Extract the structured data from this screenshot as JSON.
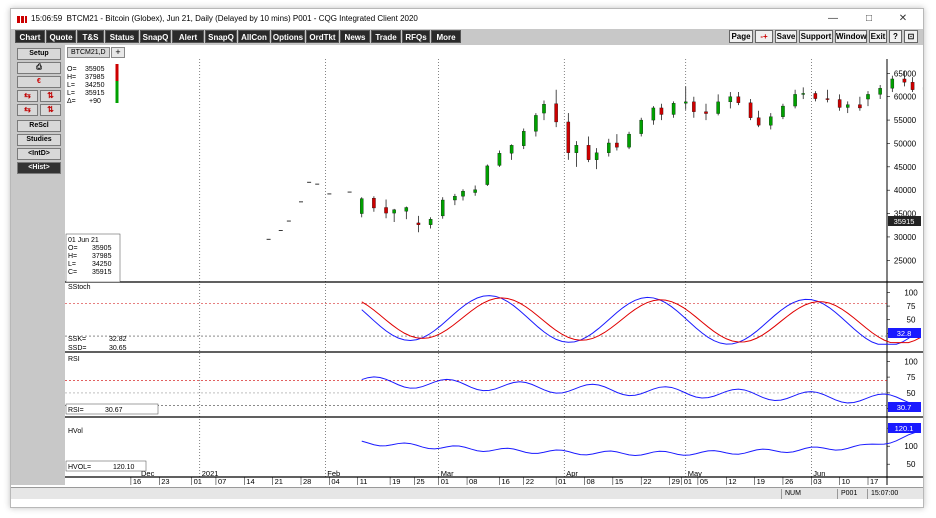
{
  "window": {
    "time": "15:06:59",
    "title": "BTCM21 - Bitcoin (Globex), Jun 21, Daily (Delayed by 10 mins)   P001 - CQG Integrated Client 2020",
    "minimize": "—",
    "maximize": "□",
    "close": "✕"
  },
  "toolbar": {
    "left_buttons": [
      "Chart",
      "Quote",
      "T&S",
      "Status",
      "SnapQ",
      "Alert",
      "SnapQ",
      "AllCon",
      "Options",
      "OrdTkt",
      "News",
      "Trade",
      "RFQs",
      "More"
    ],
    "right_buttons": [
      "Page",
      "-+",
      "Save",
      "Support",
      "Window",
      "Exit",
      "?"
    ]
  },
  "sidebar": {
    "setup": "Setup",
    "print_icon": "printer-icon",
    "rescl": "ReScl",
    "studies": "Studies",
    "intd": "<IntD>",
    "hist": "<Hist>"
  },
  "tab": {
    "label": "BTCM21,D",
    "add": "+"
  },
  "ohlc_box": {
    "open_label": "O=",
    "open": "35905",
    "high_label": "H=",
    "high": "37985",
    "low_label": "L=",
    "low": "34250",
    "last_label": "L=",
    "last": "35915",
    "change_label": "Δ=",
    "change": "+90"
  },
  "cursor_box": {
    "date": "01  Jun 21",
    "o_label": "O=",
    "o": "35905",
    "h_label": "H=",
    "h": "37985",
    "l_label": "L=",
    "l": "34250",
    "c_label": "C=",
    "c": "35915"
  },
  "panels": {
    "sstoch": {
      "title": "SStoch",
      "ssk_label": "SSK=",
      "ssk": "32.82",
      "ssd_label": "SSD=",
      "ssd": "30.65",
      "badge": "32.8"
    },
    "rsi": {
      "title": "RSI",
      "value_label": "RSI=",
      "value": "30.67",
      "badge": "30.7"
    },
    "hvol": {
      "title": "HVol",
      "value_label": "HVOL=",
      "value": "120.10",
      "badge": "120.1"
    }
  },
  "price_badge": "35915",
  "statusbar": {
    "num": "NUM",
    "page": "P001",
    "time": "15:07:00"
  },
  "colors": {
    "up": "#00a000",
    "down": "#cc0000",
    "fast": "#1a1aff",
    "slow": "#e00000",
    "badge": "#1a1aff"
  },
  "chart_data": {
    "type": "candlestick",
    "price_axis": {
      "ticks": [
        25000,
        30000,
        35000,
        40000,
        45000,
        50000,
        55000,
        60000,
        65000
      ],
      "range": [
        21000,
        67000
      ]
    },
    "sstoch_axis": {
      "ticks": [
        100,
        75,
        50,
        25
      ]
    },
    "rsi_axis": {
      "ticks": [
        100,
        75,
        50,
        25
      ]
    },
    "hvol_axis": {
      "ticks": [
        150,
        100,
        50
      ]
    },
    "month_labels": [
      {
        "label": "Dec",
        "day": 0
      },
      {
        "label": "2021",
        "day": 15
      },
      {
        "label": "Feb",
        "day": 46
      },
      {
        "label": "Mar",
        "day": 74
      },
      {
        "label": "Apr",
        "day": 105
      },
      {
        "label": "May",
        "day": 135
      },
      {
        "label": "Jun",
        "day": 166
      }
    ],
    "day_labels": [
      {
        "label": "16",
        "day": -2
      },
      {
        "label": "23",
        "day": 5
      },
      {
        "label": "01",
        "day": 13
      },
      {
        "label": "07",
        "day": 19
      },
      {
        "label": "14",
        "day": 26
      },
      {
        "label": "21",
        "day": 33
      },
      {
        "label": "28",
        "day": 40
      },
      {
        "label": "04",
        "day": 47
      },
      {
        "label": "11",
        "day": 54
      },
      {
        "label": "19",
        "day": 62
      },
      {
        "label": "25",
        "day": 68
      },
      {
        "label": "01",
        "day": 74
      },
      {
        "label": "08",
        "day": 81
      },
      {
        "label": "16",
        "day": 89
      },
      {
        "label": "22",
        "day": 95
      },
      {
        "label": "01",
        "day": 103
      },
      {
        "label": "08",
        "day": 110
      },
      {
        "label": "15",
        "day": 117
      },
      {
        "label": "22",
        "day": 124
      },
      {
        "label": "29",
        "day": 131
      },
      {
        "label": "01",
        "day": 134
      },
      {
        "label": "05",
        "day": 138
      },
      {
        "label": "12",
        "day": 145
      },
      {
        "label": "19",
        "day": 152
      },
      {
        "label": "26",
        "day": 159
      },
      {
        "label": "03",
        "day": 166
      },
      {
        "label": "10",
        "day": 173
      },
      {
        "label": "17",
        "day": 180
      },
      {
        "label": "24",
        "day": 187
      },
      {
        "label": "01",
        "day": 194
      }
    ],
    "dashes": [
      {
        "day": 32,
        "close": 29500
      },
      {
        "day": 35,
        "close": 31400
      },
      {
        "day": 37,
        "close": 33400
      },
      {
        "day": 40,
        "close": 37500
      },
      {
        "day": 42,
        "close": 41700
      },
      {
        "day": 44,
        "close": 41300
      },
      {
        "day": 47,
        "close": 39200
      },
      {
        "day": 52,
        "close": 39600
      }
    ],
    "candles": [
      [
        55,
        35000,
        38500,
        34200,
        38200
      ],
      [
        58,
        38300,
        38700,
        35400,
        36200
      ],
      [
        61,
        36300,
        38000,
        34000,
        35100
      ],
      [
        63,
        35100,
        36000,
        33200,
        35800
      ],
      [
        66,
        35500,
        36500,
        33800,
        36300
      ],
      [
        69,
        33000,
        34500,
        31000,
        32600
      ],
      [
        72,
        32600,
        34200,
        31800,
        33800
      ],
      [
        75,
        34500,
        38500,
        33900,
        37900
      ],
      [
        78,
        37900,
        39200,
        36800,
        38700
      ],
      [
        80,
        38700,
        40200,
        37800,
        39800
      ],
      [
        83,
        39500,
        41000,
        38800,
        40100
      ],
      [
        86,
        41200,
        45500,
        40900,
        45200
      ],
      [
        89,
        45300,
        48500,
        45000,
        47900
      ],
      [
        92,
        47900,
        49800,
        46500,
        49600
      ],
      [
        95,
        49500,
        53200,
        48800,
        52600
      ],
      [
        98,
        52600,
        56500,
        51500,
        56000
      ],
      [
        100,
        56500,
        59200,
        55000,
        58400
      ],
      [
        103,
        58500,
        61500,
        53500,
        54600
      ],
      [
        106,
        54600,
        56500,
        46500,
        48000
      ],
      [
        108,
        48000,
        50500,
        45000,
        49600
      ],
      [
        111,
        49600,
        51500,
        46000,
        46500
      ],
      [
        113,
        46500,
        49000,
        44500,
        48000
      ],
      [
        116,
        48000,
        51000,
        47200,
        50100
      ],
      [
        118,
        50100,
        52000,
        48500,
        49200
      ],
      [
        121,
        49200,
        52500,
        48800,
        52000
      ],
      [
        124,
        52100,
        55500,
        51500,
        55000
      ],
      [
        127,
        55000,
        58000,
        54000,
        57600
      ],
      [
        129,
        57600,
        58500,
        55000,
        56200
      ],
      [
        132,
        56200,
        59000,
        55500,
        58600
      ],
      [
        135,
        58600,
        62200,
        57200,
        58900
      ],
      [
        137,
        58900,
        60000,
        55500,
        56800
      ],
      [
        140,
        56800,
        58500,
        55000,
        56400
      ],
      [
        143,
        56400,
        60500,
        56000,
        58900
      ],
      [
        146,
        58900,
        61000,
        57500,
        60000
      ],
      [
        148,
        60000,
        61000,
        58200,
        58700
      ],
      [
        151,
        58700,
        59500,
        55000,
        55500
      ],
      [
        153,
        55500,
        57000,
        53500,
        53900
      ],
      [
        156,
        53900,
        56500,
        53000,
        55700
      ],
      [
        159,
        55700,
        58500,
        55200,
        58000
      ],
      [
        162,
        58000,
        61500,
        57500,
        60500
      ],
      [
        164,
        60500,
        62000,
        59500,
        60700
      ],
      [
        167,
        60700,
        61200,
        59000,
        59600
      ],
      [
        170,
        59600,
        61500,
        58800,
        59400
      ],
      [
        173,
        59400,
        60500,
        57000,
        57700
      ],
      [
        175,
        57700,
        59000,
        56500,
        58300
      ],
      [
        178,
        58300,
        60000,
        57000,
        57600
      ],
      [
        180,
        59500,
        61200,
        58000,
        60500
      ],
      [
        183,
        60500,
        62500,
        59500,
        61800
      ],
      [
        186,
        61800,
        64500,
        61000,
        63800
      ],
      [
        189,
        63800,
        65500,
        62200,
        63100
      ],
      [
        191,
        63100,
        64200,
        61000,
        61500
      ],
      [
        194,
        61500,
        63000,
        60500,
        62000
      ]
    ]
  }
}
